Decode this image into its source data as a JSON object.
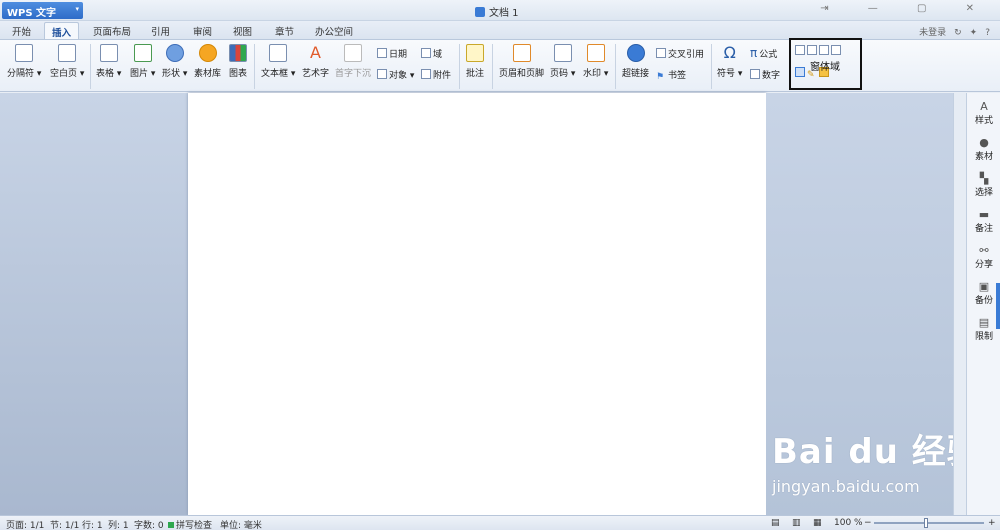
{
  "titlebar": {
    "app_button": "WPS 文字",
    "document_title": "文档 1",
    "window_controls": "⇥ — ▢ ✕"
  },
  "tabs": [
    "开始",
    "插入",
    "页面布局",
    "引用",
    "审阅",
    "视图",
    "章节",
    "办公空间"
  ],
  "tab_right": {
    "login": "未登录",
    "help": "?"
  },
  "ribbon": {
    "page_break": "分隔符",
    "blank_page": "空白页",
    "table": "表格",
    "picture": "图片",
    "shape": "形状",
    "material": "素材库",
    "chart": "图表",
    "textbox": "文本框",
    "wordart": "艺术字",
    "dropcap": "首字下沉",
    "date": "日期",
    "field": "域",
    "object": "对象",
    "attachment": "附件",
    "comment": "批注",
    "header_footer": "页眉和页脚",
    "page_number": "页码",
    "watermark": "水印",
    "hyperlink": "超链接",
    "cross_ref": "交叉引用",
    "bookmark": "书签",
    "symbol": "符号",
    "formula": "公式",
    "number": "数字",
    "form_tooltip": "窗体域"
  },
  "sidebar": [
    "样式",
    "素材",
    "选择",
    "备注",
    "分享",
    "备份",
    "限制"
  ],
  "statusbar": {
    "page": "页面: 1/1",
    "section": "节: 1/1",
    "row": "行: 1",
    "col": "列: 1",
    "words": "字数: 0",
    "spell": "拼写检查",
    "unit": "单位: 毫米",
    "zoom": "100 %"
  },
  "watermark": {
    "line1": "Bai du 经验",
    "line2": "jingyan.baidu.com"
  },
  "colors": {
    "accent": "#3a7bd5",
    "page": "#ffffff",
    "background": "#b4c3d8"
  }
}
